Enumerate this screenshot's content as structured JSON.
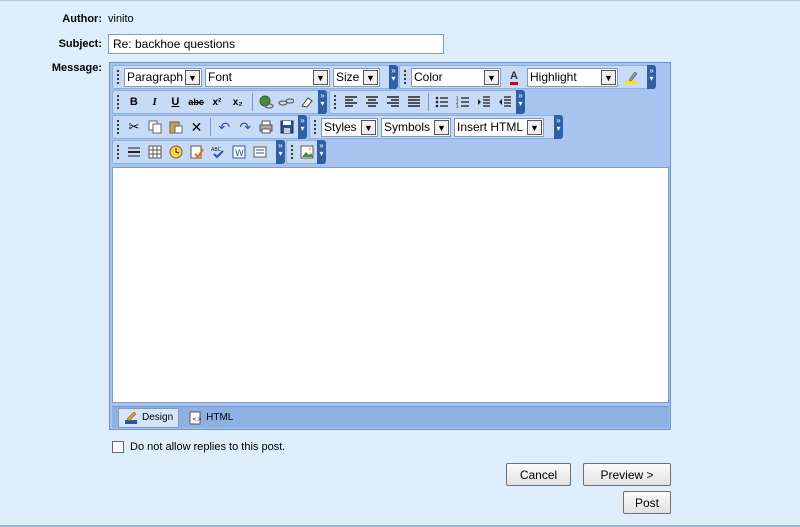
{
  "form": {
    "author_label": "Author:",
    "author_value": "vinito",
    "subject_label": "Subject:",
    "subject_value": "Re: backhoe questions",
    "message_label": "Message:"
  },
  "toolbar1": {
    "paragraph": "Paragraph",
    "font": "Font",
    "size": "Size",
    "color": "Color",
    "highlight": "Highlight"
  },
  "toolbar2": {
    "bold": "B",
    "italic": "I",
    "underline": "U",
    "strike": "abc",
    "superscript": "x²",
    "subscript": "x₂"
  },
  "toolbar3": {
    "styles": "Styles",
    "symbols": "Symbols",
    "insert_html": "Insert HTML"
  },
  "modes": {
    "design": "Design",
    "html": "HTML"
  },
  "options": {
    "no_replies": "Do not allow replies to this post."
  },
  "buttons": {
    "cancel": "Cancel",
    "preview": "Preview >",
    "post": "Post"
  },
  "colors": {
    "background": "#dfeefc",
    "editor_frame": "#a6c4ef",
    "toolbar": "#c7dbf7"
  }
}
